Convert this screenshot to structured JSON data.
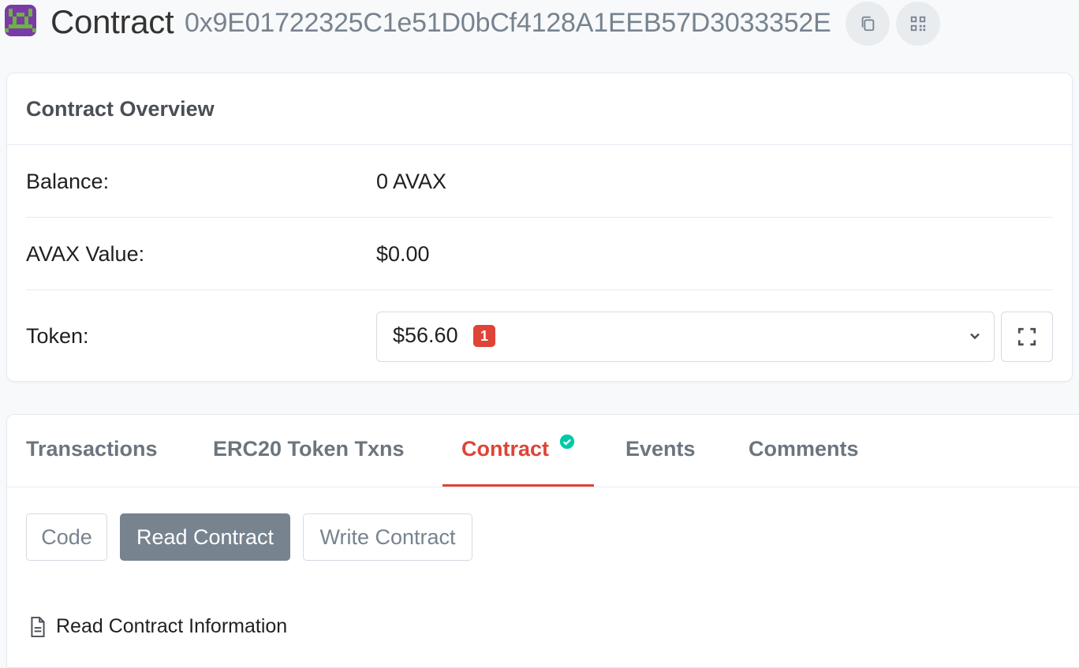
{
  "header": {
    "title": "Contract",
    "address": "0x9E01722325C1e51D0bCf4128A1EEB57D3033352E",
    "copy_icon": "copy-icon",
    "qr_icon": "qr-code-icon"
  },
  "overview": {
    "title": "Contract Overview",
    "rows": [
      {
        "label": "Balance:",
        "value": "0 AVAX"
      },
      {
        "label": "AVAX Value:",
        "value": "$0.00"
      },
      {
        "label": "Token:",
        "value": "$56.60",
        "badge": "1"
      }
    ],
    "expand_icon": "expand-icon"
  },
  "tabs": [
    {
      "label": "Transactions",
      "active": false
    },
    {
      "label": "ERC20 Token Txns",
      "active": false
    },
    {
      "label": "Contract",
      "active": true,
      "verified": true
    },
    {
      "label": "Events",
      "active": false
    },
    {
      "label": "Comments",
      "active": false
    }
  ],
  "contract_buttons": [
    {
      "label": "Code",
      "active": false
    },
    {
      "label": "Read Contract",
      "active": true
    },
    {
      "label": "Write Contract",
      "active": false
    }
  ],
  "info": {
    "text": "Read Contract Information",
    "icon": "document-icon"
  },
  "colors": {
    "accent": "#de4437",
    "verified": "#00c9a7",
    "muted": "#77838f"
  }
}
